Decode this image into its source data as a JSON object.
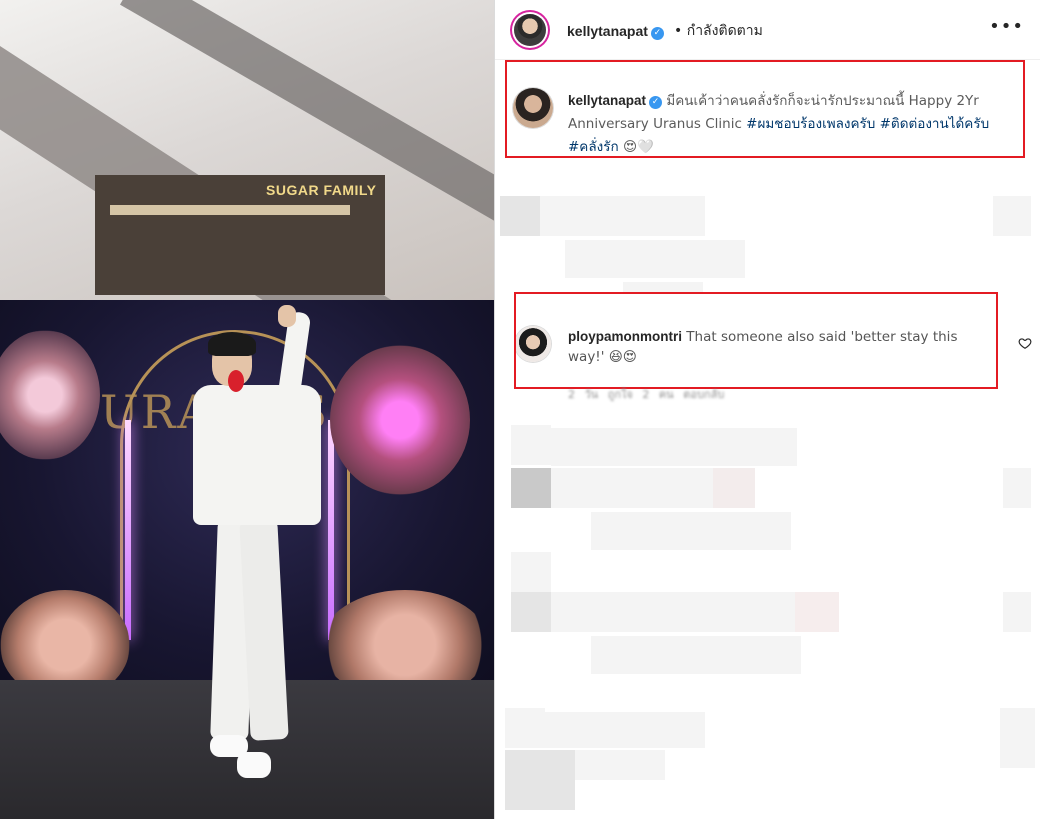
{
  "photo": {
    "shop_sign": "SUGAR FAMILY",
    "stage_sign": "URANUS"
  },
  "post_header": {
    "username": "kellytanapat",
    "separator": "•",
    "follow_status": "กำลังติดตาม",
    "more_icon": "ellipsis-icon",
    "verified_icon": "verified-badge-icon"
  },
  "caption": {
    "username": "kellytanapat",
    "text_before": " มีคนเค้าว่าคนคลั่งรักก็จะน่ารักประมาณนี้ Happy 2Yr Anniversary Uranus Clinic ",
    "hashtags": [
      "#ผมชอบร้องเพลงครับ",
      "#ติดต่องานได้ครับ",
      "#คลั่งรัก"
    ],
    "emoji": "😍🤍"
  },
  "comment": {
    "username": "ploypamonmontri",
    "text": " That someone also said 'better stay this way!' 😆😍",
    "meta": "2 วัน   ถูกใจ 2 คน   ตอบกลับ",
    "like_icon": "heart-outline-icon"
  },
  "colors": {
    "highlight_box": "#e31b23",
    "hashtag": "#00376b",
    "verified": "#3897f0",
    "username": "#262626"
  }
}
